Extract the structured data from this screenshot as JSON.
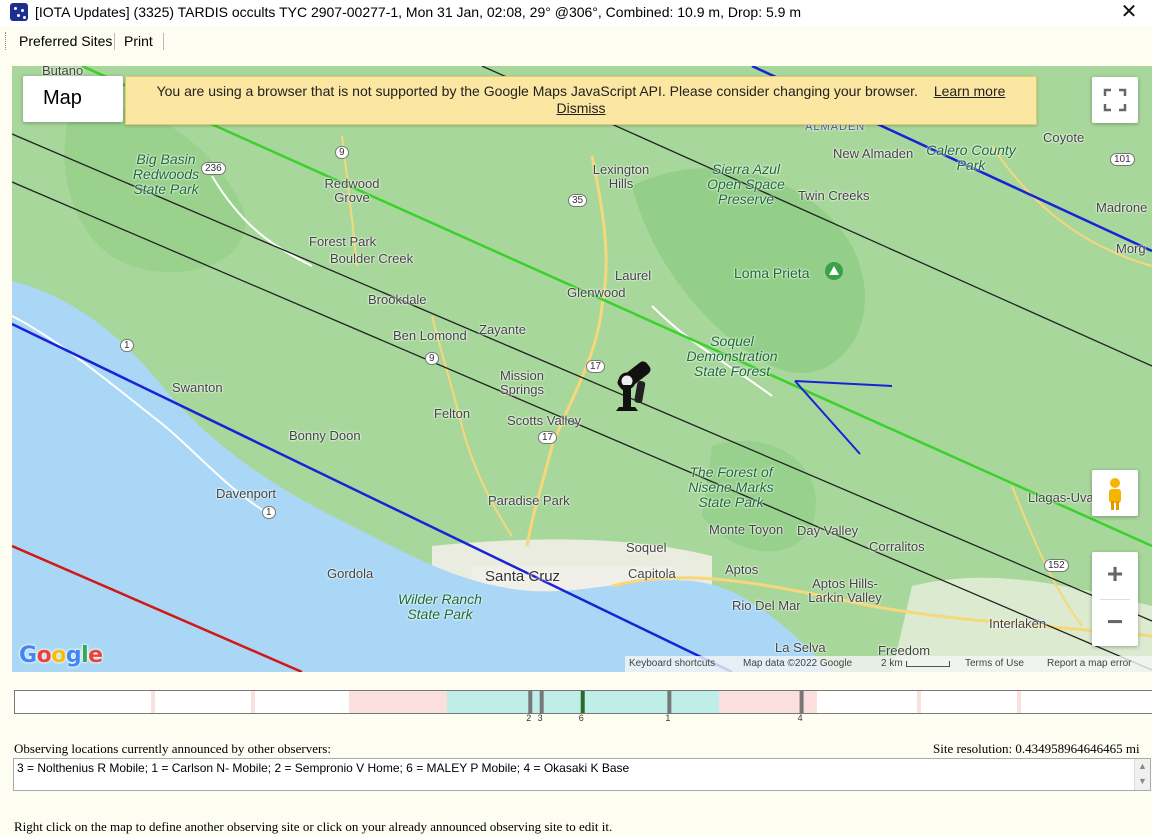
{
  "window": {
    "title": "[IOTA Updates] (3325) TARDIS occults TYC 2907-00277-1, Mon 31 Jan, 02:08, 29° @306°, Combined: 10.9 m, Drop:  5.9 m",
    "close_glyph": "✕",
    "icon": "star-globe-icon"
  },
  "menu": {
    "items": [
      "Preferred Sites",
      "Print"
    ]
  },
  "map": {
    "type_button": "Map",
    "banner": {
      "message": "You are using a browser that is not supported by the Google Maps JavaScript API. Please consider changing your browser.",
      "learn_more": "Learn more",
      "dismiss": "Dismiss"
    },
    "logo": "Google",
    "zoom_in": "+",
    "zoom_out": "−",
    "attribution": {
      "shortcuts": "Keyboard shortcuts",
      "data": "Map data ©2022 Google",
      "scale": "2 km",
      "terms": "Terms of Use",
      "report": "Report a map error"
    },
    "places": {
      "butano": "Butano",
      "big_basin": "Big Basin Redwoods State Park",
      "redwood_grove": "Redwood Grove",
      "lexington_hills": "Lexington Hills",
      "sierra_azul": "Sierra Azul Open Space Preserve",
      "almaden": "ALMADEN",
      "new_almaden": "New Almaden",
      "calero": "Calero County Park",
      "coyote": "Coyote",
      "twin_creeks": "Twin Creeks",
      "madrone": "Madrone",
      "morg": "Morg",
      "forest_park": "Forest Park",
      "boulder_creek": "Boulder Creek",
      "laurel": "Laurel",
      "glenwood": "Glenwood",
      "loma_prieta": "Loma Prieta",
      "brookdale": "Brookdale",
      "ben_lomond": "Ben Lomond",
      "zayante": "Zayante",
      "soquel_forest": "Soquel Demonstration State Forest",
      "swanton": "Swanton",
      "mission_springs": "Mission Springs",
      "felton": "Felton",
      "scotts_valley": "Scotts Valley",
      "bonny_doon": "Bonny Doon",
      "forest_nisene": "The Forest of Nisene Marks State Park",
      "llagas": "Llagas-Uva",
      "davenport": "Davenport",
      "paradise_park": "Paradise Park",
      "monte_toyon": "Monte Toyon",
      "day_valley": "Day Valley",
      "corralitos": "Corralitos",
      "soquel": "Soquel",
      "santa_cruz": "Santa Cruz",
      "capitola": "Capitola",
      "aptos": "Aptos",
      "gordola": "Gordola",
      "wilder_ranch": "Wilder Ranch State Park",
      "rio_del_mar": "Rio Del Mar",
      "aptos_hills": "Aptos Hills-Larkin Valley",
      "interlaken": "Interlaken",
      "la_selva": "La Selva",
      "freedom": "Freedom"
    },
    "routes": [
      "9",
      "236",
      "35",
      "101",
      "1",
      "9",
      "17",
      "17",
      "1",
      "152"
    ]
  },
  "timeline": {
    "markers": [
      {
        "label": "2",
        "fraction": 0.452
      },
      {
        "label": "3",
        "fraction": 0.462
      },
      {
        "label": "6",
        "fraction": 0.498
      },
      {
        "label": "1",
        "fraction": 0.574
      },
      {
        "label": "4",
        "fraction": 0.69
      }
    ]
  },
  "observers": {
    "label": "Observing locations currently announced by other observers:",
    "list": "3 = Nolthenius R Mobile; 1 = Carlson N-  Mobile; 2 = Sempronio V Home; 6 = MALEY P Mobile; 4 = Okasaki K Base",
    "resolution": "Site resolution: 0.434958964646465 mi"
  },
  "footer": {
    "instruction": "Right click on the map to define another observing site or click on your already announced observing site to edit it."
  },
  "colors": {
    "center_line": "#3ad12a",
    "path_limit": "#1a22d6",
    "error_line": "#d01818",
    "sigma_line": "#222222",
    "ocean": "#a9d7f5",
    "land": "#a6d69a",
    "banner": "#fbe6a2"
  }
}
